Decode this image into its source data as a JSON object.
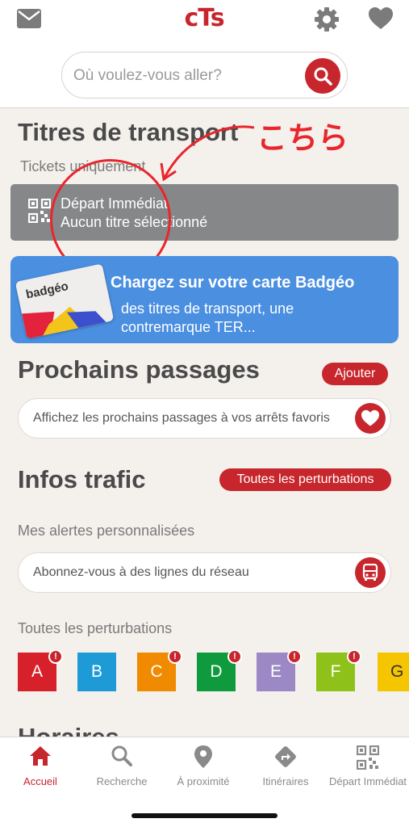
{
  "header": {
    "logo": "cTs",
    "search_placeholder": "Où voulez-vous aller?"
  },
  "tickets": {
    "title": "Titres de transport",
    "subtitle": "Tickets uniquement",
    "line1": "Départ Immédiat",
    "line2": "Aucun titre sélectionné"
  },
  "annotation": {
    "text": "こちら",
    "color": "#e8262c"
  },
  "badgeo": {
    "card_word": "badgéo",
    "title": "Chargez sur votre carte Badgéo",
    "desc_line1": "des titres de transport, une",
    "desc_line2": "contremarque TER..."
  },
  "passages": {
    "title": "Prochains passages",
    "add_label": "Ajouter",
    "field_text": "Affichez les prochains passages à vos arrêts favoris"
  },
  "traffic": {
    "title": "Infos trafic",
    "all_button": "Toutes les perturbations",
    "alerts_label": "Mes alertes personnalisées",
    "subscribe_text": "Abonnez-vous à des lignes du réseau",
    "all_label": "Toutes les perturbations",
    "lines": [
      {
        "letter": "A",
        "color": "#d6202a",
        "alert": "!"
      },
      {
        "letter": "B",
        "color": "#1e9bd7",
        "alert": ""
      },
      {
        "letter": "C",
        "color": "#f08a00",
        "alert": "!"
      },
      {
        "letter": "D",
        "color": "#109a3e",
        "alert": "!"
      },
      {
        "letter": "E",
        "color": "#9b88c4",
        "alert": "!"
      },
      {
        "letter": "F",
        "color": "#8ec21a",
        "alert": "!"
      },
      {
        "letter": "G",
        "color": "#f5c500",
        "alert": ""
      }
    ]
  },
  "horaires": {
    "title": "Horaires"
  },
  "nav": [
    {
      "label": "Accueil",
      "icon": "home-icon",
      "active": true
    },
    {
      "label": "Recherche",
      "icon": "search-icon",
      "active": false
    },
    {
      "label": "À proximité",
      "icon": "location-pin-icon",
      "active": false
    },
    {
      "label": "Itinéraires",
      "icon": "directions-icon",
      "active": false
    },
    {
      "label": "Départ Immédiat",
      "icon": "qr-code-icon",
      "active": false
    }
  ],
  "colors": {
    "brand_red": "#c8262d",
    "badgeo_blue": "#4a8fe0",
    "ticket_gray": "#858789",
    "background": "#f4f1ed"
  }
}
